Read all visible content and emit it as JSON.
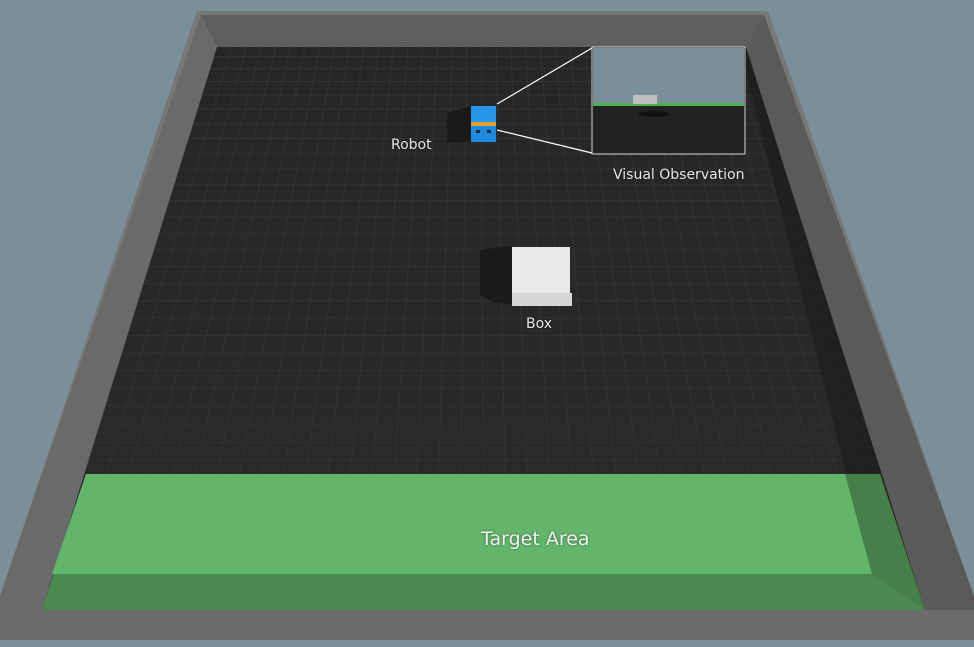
{
  "labels": {
    "robot": "Robot",
    "box": "Box",
    "visual_observation": "Visual Observation",
    "target_area": "Target Area"
  },
  "colors": {
    "background": "#7b8f9b",
    "wall_outer": "#666666",
    "wall_top": "#777777",
    "floor": "#262626",
    "grid_line": "#333333",
    "target_area": "#62b56a",
    "target_area_shadow": "#4a8a4e",
    "robot_body": "#1f8be0",
    "robot_band": "#e0a030",
    "box": "#e8e8e8",
    "sky": "#7b8f9b"
  }
}
